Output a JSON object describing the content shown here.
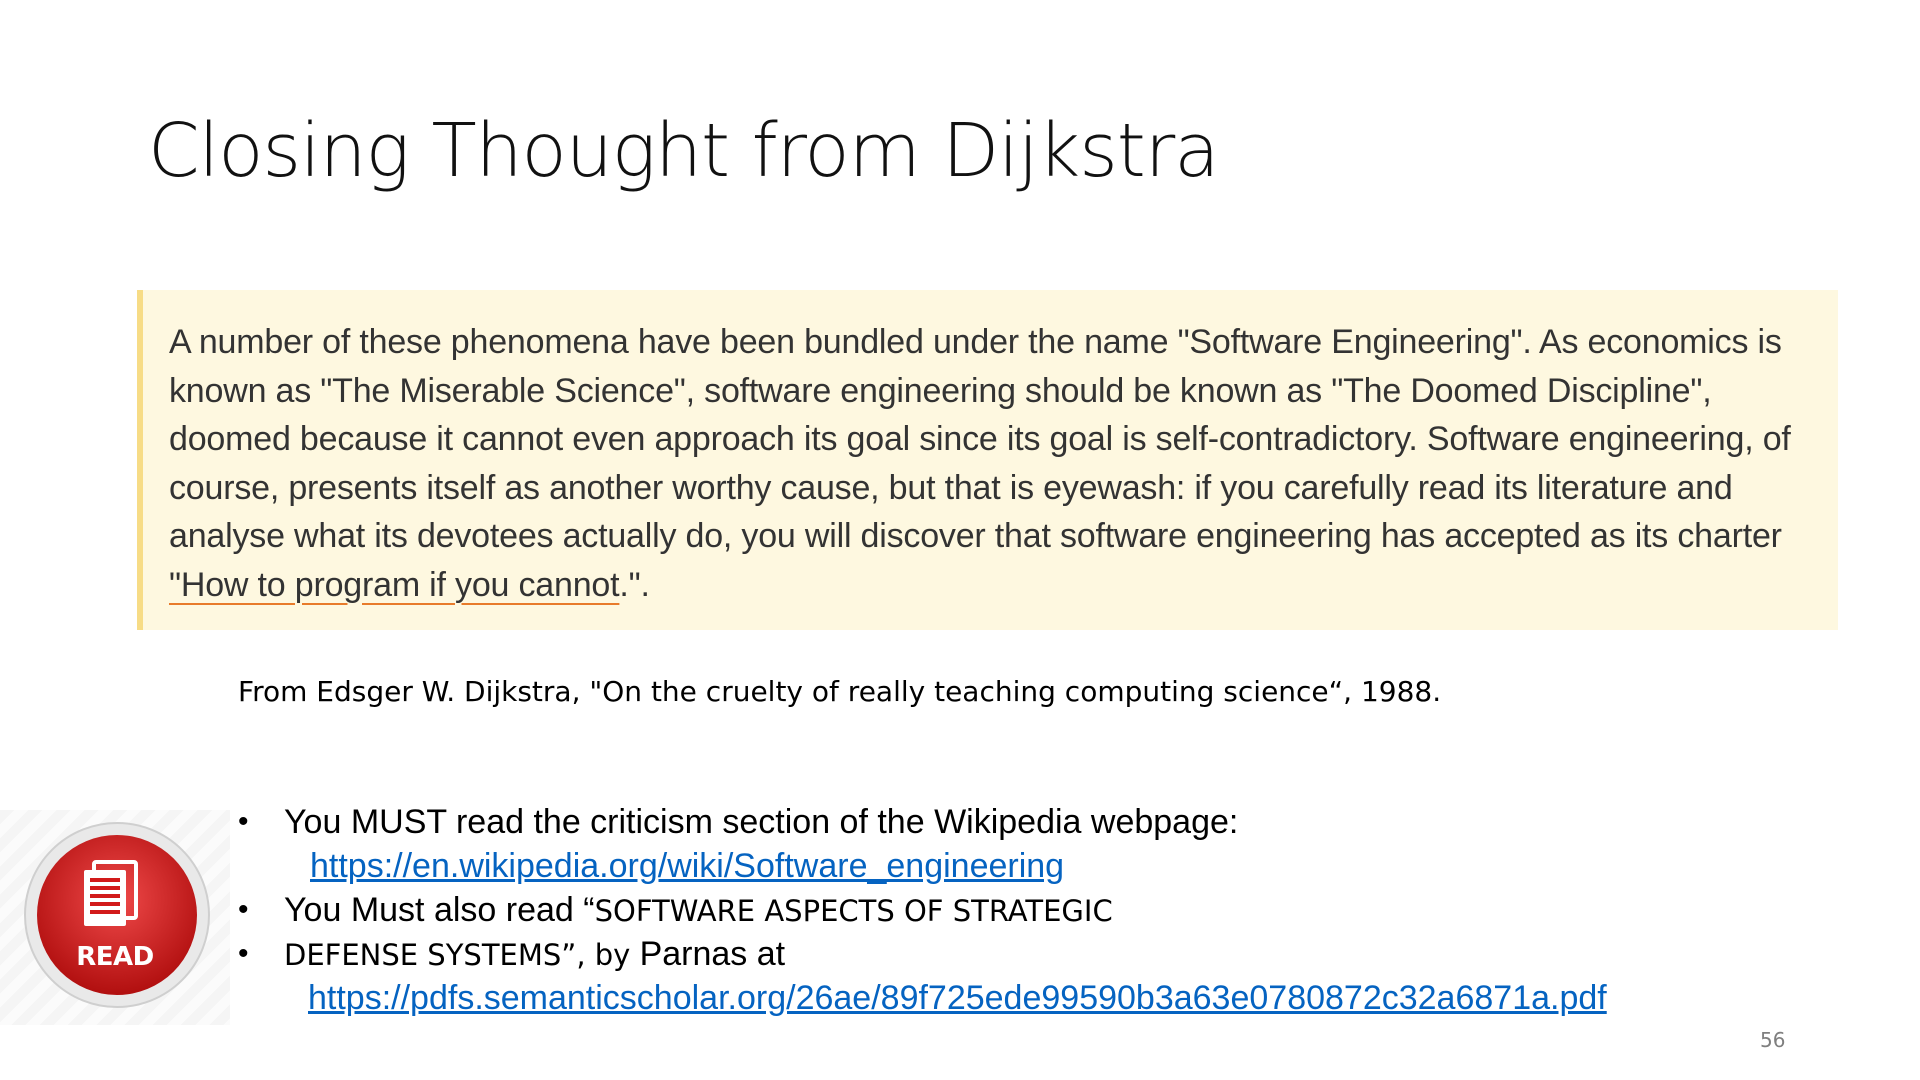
{
  "slide": {
    "title": "Closing Thought from Dijkstra",
    "quote": {
      "before": "A number of these phenomena have been bundled under the name \"Software Engineering\". As economics is known as \"The Miserable Science\", software engineering should be known as \"The Doomed Discipline\", doomed because it cannot even approach its goal since its goal is self-contradictory. Software engineering, of course, presents itself as another worthy cause, but that is eyewash: if you carefully read its literature and analyse what its devotees actually do, you will discover that software engineering has accepted as its charter",
      "underlined": " \"How to program if you cannot",
      "after": ".\"."
    },
    "attribution": "From Edsger W. Dijkstra, \"On the cruelty of really teaching computing science“, 1988.",
    "bullets": {
      "bullet_char": "•",
      "item1_text": "You MUST read the criticism section of the Wikipedia webpage:",
      "item1_link": "https://en.wikipedia.org/wiki/Software_engineering",
      "item2_text_a": "You Must also read “",
      "item2_text_b": "SOFTWARE ASPECTS OF STRATEGIC",
      "item3_text_a": "DEFENSE SYSTEMS”, by ",
      "item3_text_b": "Parnas at",
      "item3_link": "https://pdfs.semanticscholar.org/26ae/89f725ede99590b3a63e0780872c32a6871a.pdf"
    },
    "badge": {
      "label": "READ",
      "icon": "document-icon",
      "color": "#d21a1a"
    },
    "page_number": "56",
    "colors": {
      "link": "#0563c1",
      "quote_bg": "#fef8e0",
      "quote_border": "#f7dc86",
      "underline": "#e87b2b"
    }
  }
}
